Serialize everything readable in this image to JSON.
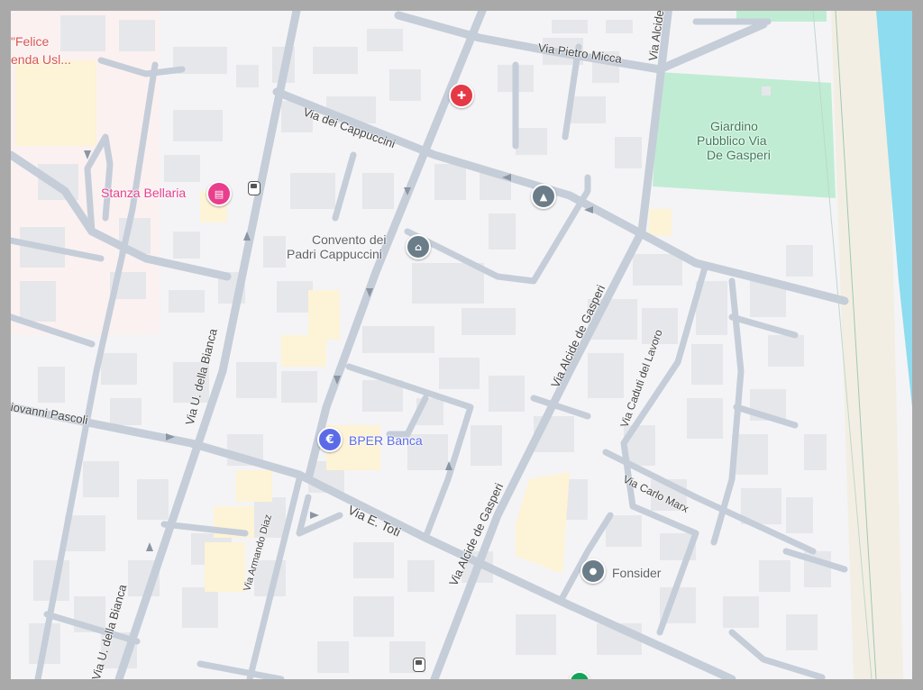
{
  "map": {
    "colors": {
      "background": "#f4f4f6",
      "road": "#c5cdd8",
      "building": "#e6e7ea",
      "park": "#c0ecd3",
      "beach": "#f3eee3",
      "sea": "#8edcef",
      "highlight_building": "#fdf3d6",
      "hotel_pin": "#e83e8c",
      "hospital_pin": "#e53945",
      "bank_pin": "#5b6be8",
      "generic_pin": "#6b7d88",
      "green_pin": "#13a356"
    },
    "streets": {
      "via_pietro_micca": "Via Pietro Micca",
      "via_alcide_top": "Via Alcide",
      "via_dei_cappuccini": "Via dei Cappuccini",
      "via_u_della_bianca_1": "Via U. della Bianca",
      "via_u_della_bianca_2": "Via U. della Bianca",
      "via_alcide_de_gasperi_1": "Via Alcide de Gasperi",
      "via_alcide_de_gasperi_2": "Via Alcide de Gasperi",
      "via_caduti_del_lavoro": "Via Caduti del Lavoro",
      "via_carlo_marx": "Via Carlo Marx",
      "via_e_toti": "Via E. Toti",
      "via_armando_diaz": "Via Armando Diaz",
      "via_giovanni_pascoli": "iovanni Pascoli"
    },
    "pois": {
      "felice_line1": "\"Felice",
      "felice_line2": "enda Usl...",
      "stanza_bellaria": "Stanza Bellaria",
      "convento_line1": "Convento dei",
      "convento_line2": "Padri Cappuccini",
      "bper_banca": "BPER Banca",
      "fonsider": "Fonsider",
      "giardino_line1": "Giardino",
      "giardino_line2": "Pubblico Via",
      "giardino_line3": "De Gasperi"
    },
    "icons": {
      "hospital": "hospital-icon",
      "hotel": "bed-icon",
      "school": "graduation-cap-icon",
      "museum": "museum-icon",
      "bank": "euro-icon",
      "place": "place-icon",
      "bus_stop": "bus-stop-icon"
    }
  }
}
